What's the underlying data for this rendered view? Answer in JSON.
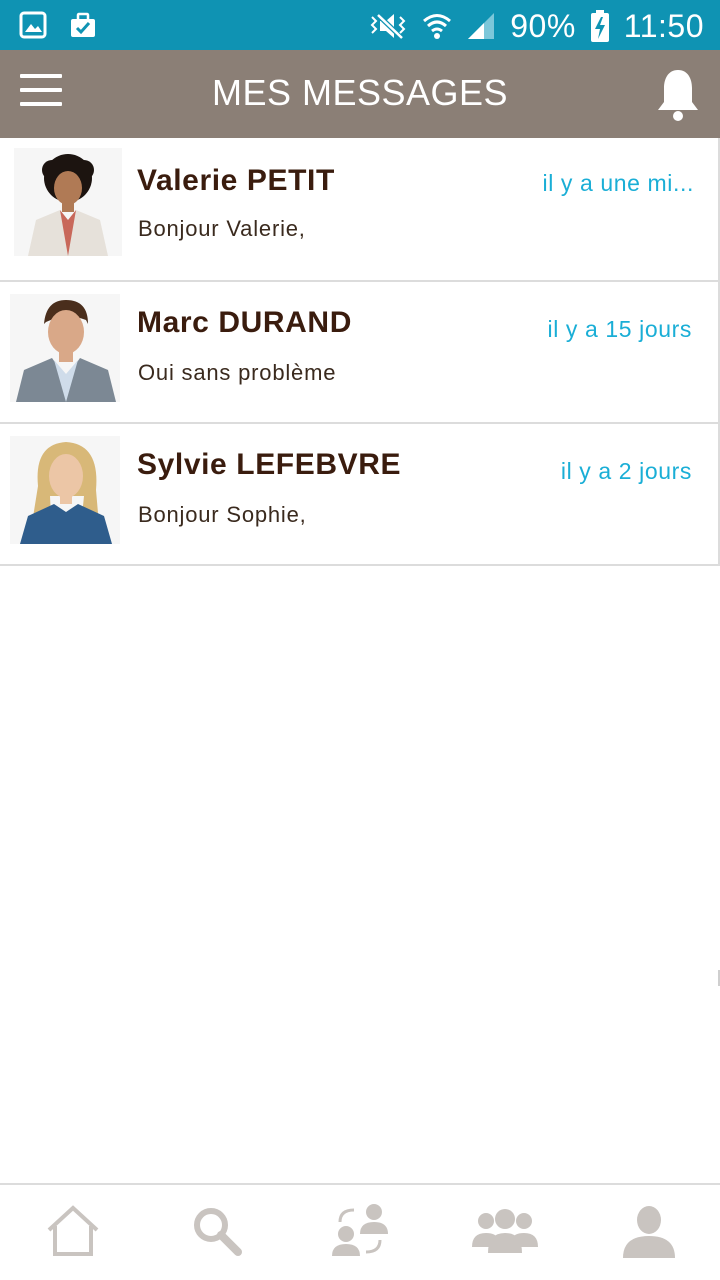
{
  "status_bar": {
    "battery": "90%",
    "time": "11:50",
    "background_color": "#0f93b3",
    "icons": [
      "gallery-icon",
      "work-bag-icon",
      "mute-icon",
      "wifi-icon",
      "signal-icon",
      "battery-charging-icon"
    ]
  },
  "header": {
    "title": "MES MESSAGES",
    "background_color": "#8b7f76",
    "menu_icon": "hamburger-menu-icon",
    "notification_icon": "bell-icon"
  },
  "messages": [
    {
      "name": "Valerie PETIT",
      "time": "il y a une mi...",
      "preview": "Bonjour Valerie,"
    },
    {
      "name": "Marc DURAND",
      "time": "il y a 15 jours",
      "preview": "Oui sans problème"
    },
    {
      "name": "Sylvie LEFEBVRE",
      "time": "il y a 2 jours",
      "preview": "Bonjour Sophie,"
    }
  ],
  "colors": {
    "name_color": "#3a1c0e",
    "time_color": "#1aaed6",
    "nav_icon_color": "#c9c4c0"
  },
  "bottom_nav": {
    "items": [
      "home-icon",
      "search-icon",
      "contact-exchange-icon",
      "group-icon",
      "profile-icon"
    ]
  }
}
